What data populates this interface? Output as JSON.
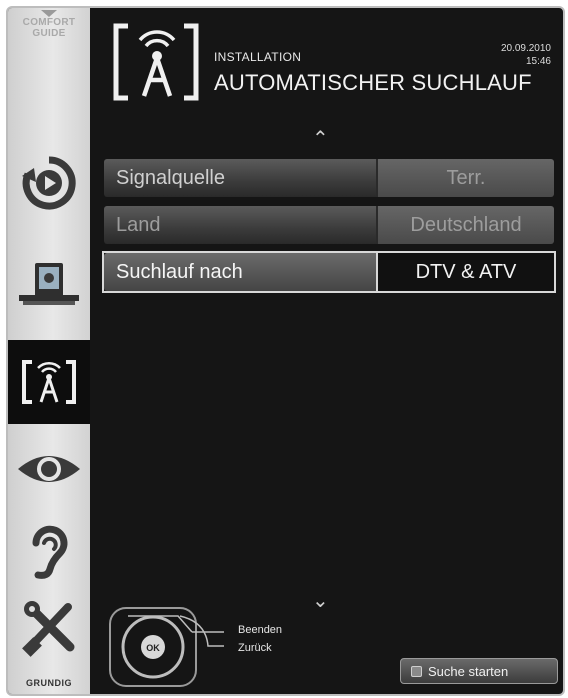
{
  "sidebar": {
    "comfort_guide": [
      "COMFORT",
      "GUIDE"
    ],
    "items": [
      {
        "icon": "playback-icon",
        "active": false
      },
      {
        "icon": "media-source-icon",
        "active": false
      },
      {
        "icon": "antenna-installation-icon",
        "active": true
      },
      {
        "icon": "eye-picture-icon",
        "active": false
      },
      {
        "icon": "ear-sound-icon",
        "active": false
      },
      {
        "icon": "tools-settings-icon",
        "active": false
      }
    ],
    "brand": "GRUNDIG"
  },
  "header": {
    "breadcrumb": "INSTALLATION",
    "title": "AUTOMATISCHER SUCHLAUF",
    "date": "20.09.2010",
    "time": "15:46"
  },
  "menu": {
    "rows": [
      {
        "label": "Signalquelle",
        "value": "Terr."
      },
      {
        "label": "Land",
        "value": "Deutschland"
      },
      {
        "label": "Suchlauf nach",
        "value": "DTV & ATV"
      }
    ]
  },
  "footer": {
    "hint_exit": "Beenden",
    "hint_back": "Zurück",
    "ok_label": "OK",
    "start_button": "Suche starten"
  },
  "colors": {
    "background": "#151515",
    "sidebar": "#dcdcdc",
    "selection_outline": "#d8d8d8"
  }
}
